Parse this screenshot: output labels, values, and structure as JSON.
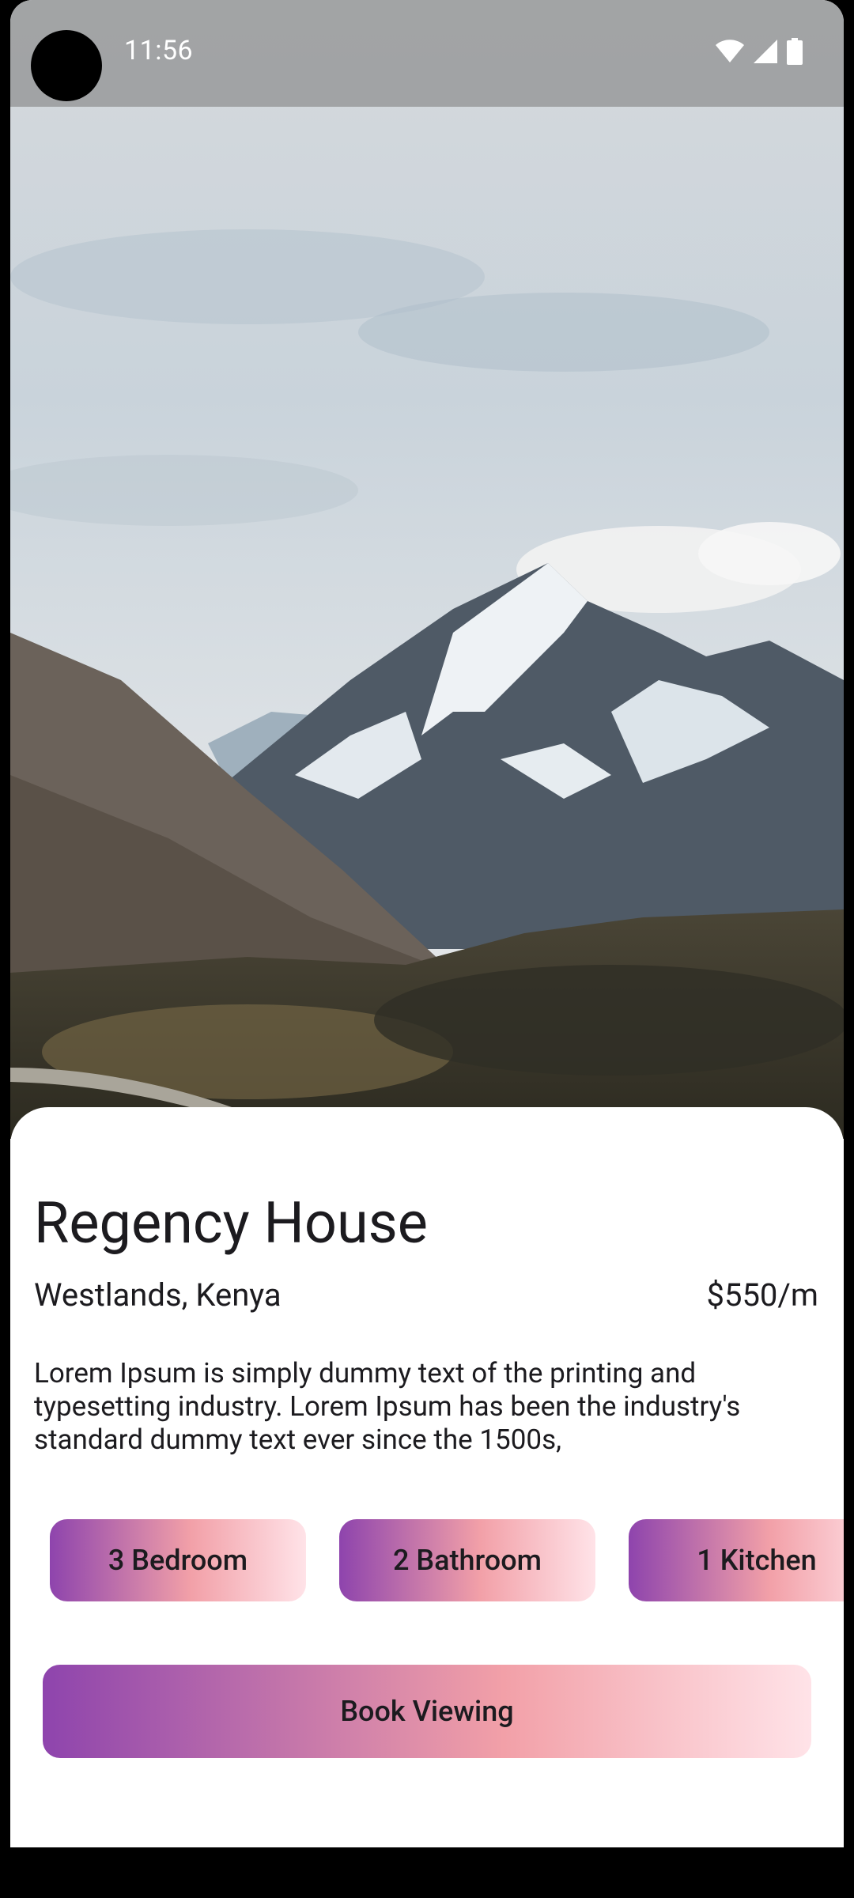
{
  "status_bar": {
    "time": "11:56",
    "icons": [
      "wifi-icon",
      "cellular-signal-icon",
      "battery-icon"
    ]
  },
  "hero": {
    "image": "mountain-landscape-photo"
  },
  "listing": {
    "title": "Regency House",
    "location": "Westlands, Kenya",
    "price": "$550/m",
    "description": "Lorem Ipsum is simply dummy text of the printing and typesetting industry. Lorem Ipsum has been the industry's standard dummy text ever since the 1500s,"
  },
  "features": [
    {
      "label": "3 Bedroom"
    },
    {
      "label": "2 Bathroom"
    },
    {
      "label": "1 Kitchen"
    }
  ],
  "actions": {
    "book_label": "Book Viewing"
  },
  "colors": {
    "gradient_start": "#8e44ad",
    "gradient_mid": "#f2a0a8",
    "gradient_end": "#ffe3e8",
    "text": "#1c1b1f"
  }
}
